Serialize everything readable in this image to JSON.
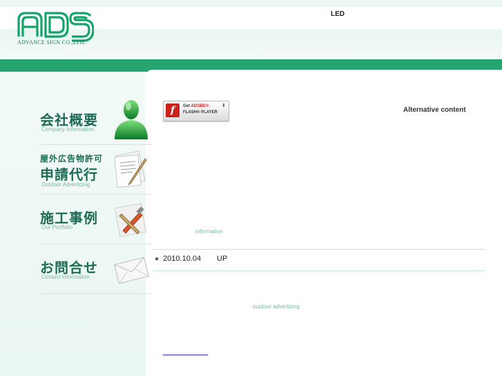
{
  "header": {
    "logo_text": "ADS",
    "tagline": "ADVANCE SIGN CO.,LTD.",
    "top_label": "LED"
  },
  "nav": [
    {
      "jp": "会社概要",
      "en": "Company Information",
      "icon": "person-icon"
    },
    {
      "jp_line1": "屋外広告物許可",
      "jp": "申請代行",
      "en": "Outdoor Advertizing",
      "icon": "documents-pen-icon"
    },
    {
      "jp": "施工事例",
      "en": "Our Portfolio",
      "icon": "tools-icon"
    },
    {
      "jp": "お問合せ",
      "en": "Contact Informaiton",
      "icon": "envelope-icon"
    }
  ],
  "flash": {
    "line1_prefix": "Get ",
    "line1_brand": "ADOBE®",
    "line2": "FLASH® PLAYER",
    "f_glyph": "f"
  },
  "alt_content": "Alternative content",
  "info_label": "information",
  "news": [
    {
      "date": "2010.10.04",
      "text": "UP"
    }
  ],
  "outdoor_label": "outdoor advertizing",
  "colors": {
    "brand_green": "#14a46a",
    "nav_text": "#1d6b55",
    "sub_text": "#7ab8a0"
  }
}
